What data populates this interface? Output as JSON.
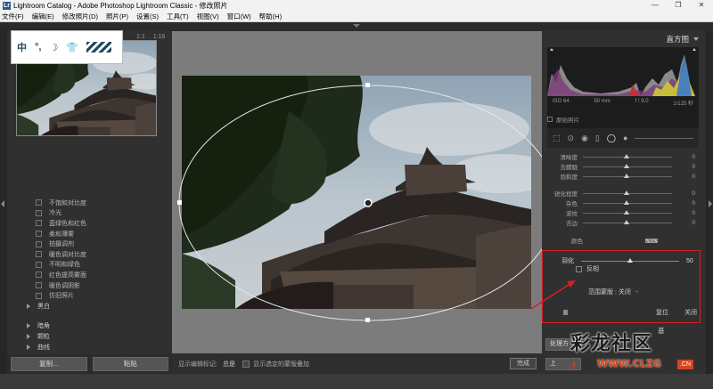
{
  "window": {
    "icon": "Lr",
    "title": "Lightroom Catalog - Adobe Photoshop Lightroom Classic - 修改照片",
    "controls": [
      "—",
      "❐",
      "✕"
    ]
  },
  "menu": [
    "文件(F)",
    "编辑(E)",
    "修改照片(D)",
    "照片(P)",
    "设置(S)",
    "工具(T)",
    "视图(V)",
    "窗口(W)",
    "帮助(H)"
  ],
  "ime_toolbar": {
    "items": [
      "中",
      "°,",
      "☽",
      "👕"
    ]
  },
  "navigator": {
    "zoom_options": [
      "1:1",
      "1:16"
    ],
    "zoom_arrow": "▾"
  },
  "presets": {
    "items": [
      "不饱和对比度",
      "冷光",
      "蓝绿色和红色",
      "柔和薄雾",
      "拍摄调剂",
      "暖色调对比度",
      "不明和绿色",
      "红色提高雾面",
      "暖色调阴影",
      "仿旧照片"
    ],
    "folders": [
      "黑白",
      "暗角",
      "颗粒",
      "曲线"
    ]
  },
  "left_buttons": {
    "copy": "复制...",
    "paste": "粘贴"
  },
  "toolbar": {
    "show_edit_pins_label": "显示编辑标记:",
    "show_edit_pins_value": "总是",
    "overlay_label": "显示选定的蒙版叠加",
    "done": "完成"
  },
  "histogram": {
    "title": "直方图",
    "iso": "ISO 64",
    "focal": "50 mm",
    "aperture": "f / 9.0",
    "shutter": "1/125 秒",
    "original_photo": "原始照片"
  },
  "adjustments": [
    {
      "label": "清晰度",
      "value": "0"
    },
    {
      "label": "去朦胧",
      "value": "0"
    },
    {
      "label": "饱和度",
      "value": "0"
    },
    {
      "label": "锐化程度",
      "value": "0"
    },
    {
      "label": "杂色",
      "value": "0"
    },
    {
      "label": "波纹",
      "value": "0"
    },
    {
      "label": "去边",
      "value": "0"
    }
  ],
  "color_label": "颜色",
  "feather": {
    "label": "羽化",
    "value": "50",
    "invert": "反相",
    "range_mask_label": "范围蒙版 :",
    "range_mask_value": "关闭",
    "reset": "复位",
    "close": "关闭"
  },
  "right_buttons": {
    "basic_fragment": "基",
    "process_fragment": "处理方",
    "upper_fragment": "上"
  },
  "watermark": {
    "main": "彩龙社区",
    "sub": "WWW.CLZG",
    "cn": ".CN"
  },
  "colors": {
    "highlight_box": "#d61f26",
    "panel_bg": "#303030",
    "canvas_bg": "#7c7c7c"
  }
}
